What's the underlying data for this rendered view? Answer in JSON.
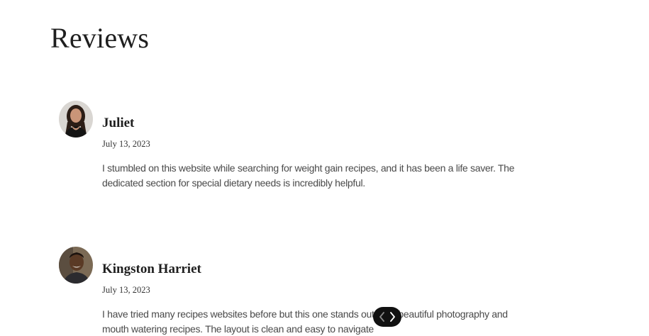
{
  "page": {
    "title": "Reviews"
  },
  "reviews": [
    {
      "name": "Juliet",
      "date": "July 13, 2023",
      "text": "I stumbled on this website while searching for weight gain recipes, and it has been a life saver. The dedicated section for special dietary needs is incredibly helpful.",
      "avatar_icon": "avatar-woman-icon"
    },
    {
      "name": "Kingston Harriet",
      "date": "July 13, 2023",
      "text": "I have tried many recipes websites before but this one stands out. The beautiful photography and mouth watering recipes. The layout is clean and easy to navigate",
      "avatar_icon": "avatar-man-icon"
    }
  ],
  "carousel": {
    "prev_icon": "chevron-left-icon",
    "next_icon": "chevron-right-icon",
    "background": "#111111"
  },
  "colors": {
    "heading": "#1f1f1f",
    "body_text": "#4a4a4a"
  }
}
